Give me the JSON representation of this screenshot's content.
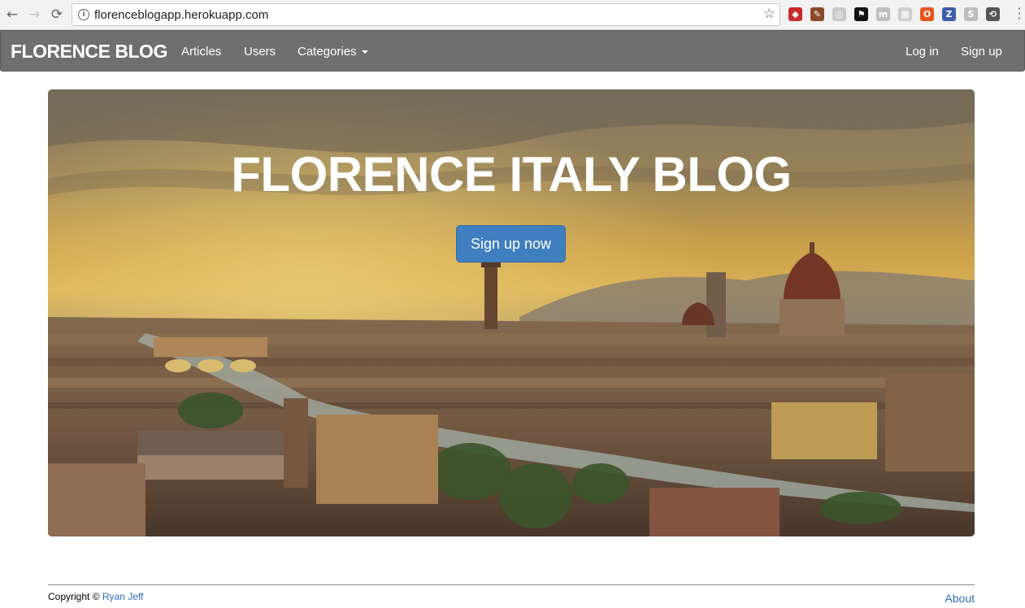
{
  "browser": {
    "url": "florenceblogapp.herokuapp.com",
    "back_icon": "←",
    "forward_icon": "→",
    "reload_icon": "⟳",
    "star_icon": "☆",
    "extensions": [
      {
        "name": "lastpass-icon",
        "glyph": "◆",
        "color": "#cc2a2a"
      },
      {
        "name": "dropper-icon",
        "glyph": "✎",
        "color": "#8a4a2a"
      },
      {
        "name": "swirl-icon",
        "glyph": "◎",
        "color": "#c9c9c9"
      },
      {
        "name": "pirate-icon",
        "glyph": "⚑",
        "color": "#111111"
      },
      {
        "name": "m-icon",
        "glyph": "m",
        "color": "#bfbfbf"
      },
      {
        "name": "grid-icon",
        "glyph": "▦",
        "color": "#cfcfcf"
      },
      {
        "name": "office-icon",
        "glyph": "O",
        "color": "#e8541c"
      },
      {
        "name": "z-icon",
        "glyph": "Z",
        "color": "#3f5ea8"
      },
      {
        "name": "skype-icon",
        "glyph": "S",
        "color": "#bdbdbd"
      },
      {
        "name": "sync-icon",
        "glyph": "⟲",
        "color": "#555555"
      }
    ]
  },
  "navbar": {
    "brand": "FLORENCE BLOG",
    "links": [
      "Articles",
      "Users",
      "Categories"
    ],
    "right_links": [
      "Log in",
      "Sign up"
    ]
  },
  "hero": {
    "title": "FLORENCE ITALY BLOG",
    "cta_label": "Sign up now"
  },
  "footer": {
    "copyright_prefix": "Copyright ©",
    "author": "Ryan Jeff",
    "about": "About"
  }
}
